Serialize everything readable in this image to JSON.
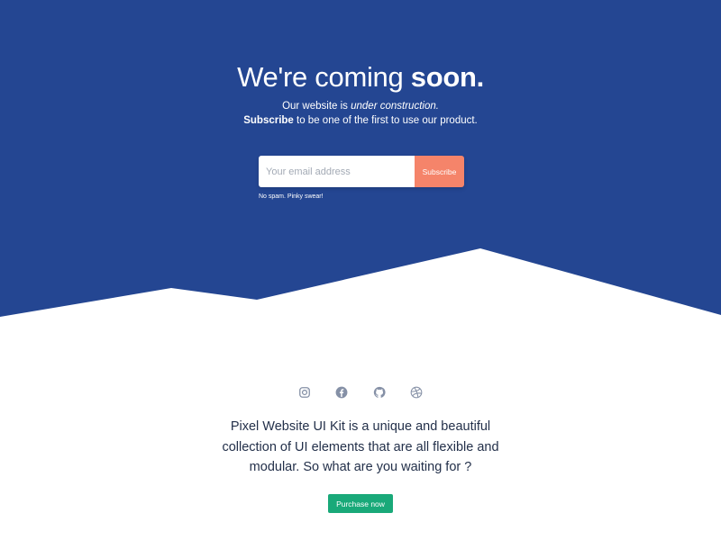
{
  "hero": {
    "title_part1": "We're coming ",
    "title_part2": "soon.",
    "subtitle_line1_prefix": "Our website is ",
    "subtitle_line1_emphasis": "under construction.",
    "subtitle_line2_strong": "Subscribe",
    "subtitle_line2_rest": " to be one of the first to use our product.",
    "background_color": "#244692"
  },
  "subscribe": {
    "email_placeholder": "Your email address",
    "button_label": "Subscribe",
    "button_color": "#f5846a",
    "note": "No spam. Pinky swear!"
  },
  "social": {
    "icons": [
      "instagram-icon",
      "facebook-icon",
      "github-icon",
      "dribbble-icon"
    ],
    "icon_color": "#8590a6"
  },
  "footer": {
    "description": "Pixel Website UI Kit is a unique and beautiful collection of UI elements that are all flexible and modular. So what are you waiting for ?",
    "purchase_label": "Purchase now",
    "purchase_color": "#19a979"
  }
}
